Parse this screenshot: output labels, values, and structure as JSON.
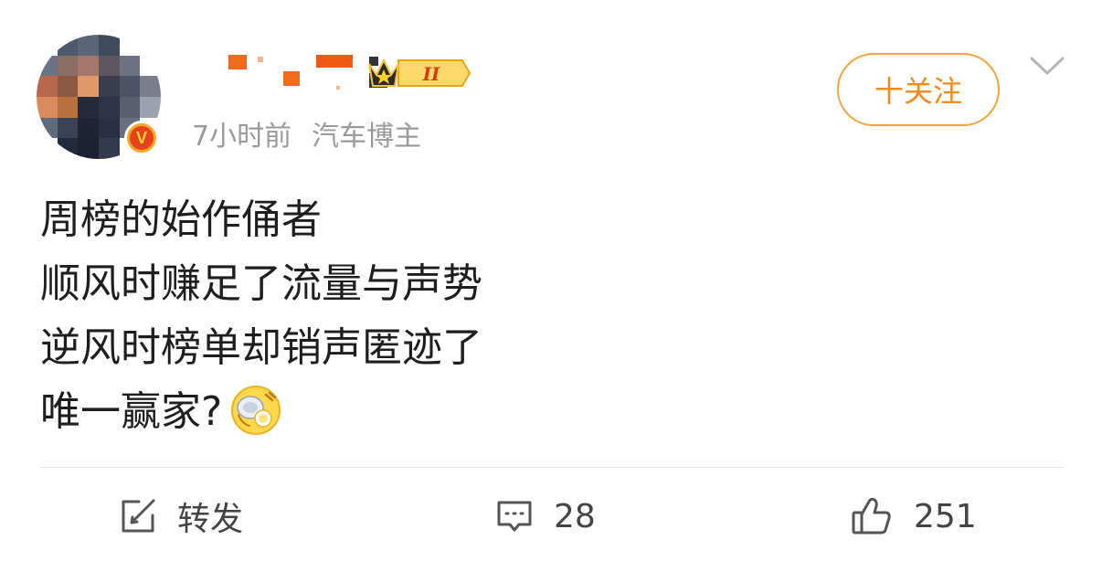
{
  "post": {
    "meta": {
      "time": "7小时前",
      "tag": "汽车博主"
    },
    "verified_mark": "V",
    "badge_level": "II",
    "follow_label": "十关注",
    "content_lines": [
      "周榜的始作俑者",
      "顺风时赚足了流量与声势",
      "逆风时榜单却销声匿迹了",
      "唯一赢家?"
    ],
    "emoji": "laughing-cry-emoji",
    "actions": {
      "repost_label": "转发",
      "comment_count": "28",
      "like_count": "251"
    }
  },
  "colors": {
    "accent": "#f08a1a",
    "follow_border": "#f3a33a",
    "meta_text": "#9a9a9a",
    "icon_gray": "#555555"
  }
}
